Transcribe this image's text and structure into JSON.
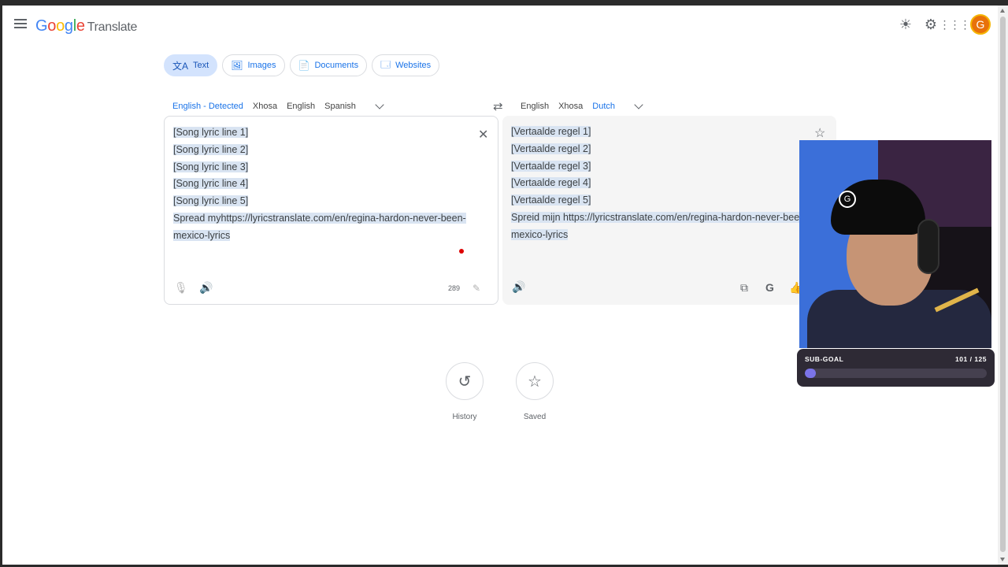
{
  "header": {
    "logo_google": "Google",
    "logo_product": "Translate",
    "avatar_letter": "G"
  },
  "modes": [
    {
      "label": "Text",
      "icon": "translate-icon",
      "active": true
    },
    {
      "label": "Images",
      "icon": "image-icon",
      "active": false
    },
    {
      "label": "Documents",
      "icon": "document-icon",
      "active": false
    },
    {
      "label": "Websites",
      "icon": "website-icon",
      "active": false
    }
  ],
  "source_langs": [
    "English - Detected",
    "Xhosa",
    "English",
    "Spanish"
  ],
  "target_langs": [
    "English",
    "Xhosa",
    "Dutch"
  ],
  "source_text": [
    "[Song lyric line 1]",
    "[Song lyric line 2]",
    "[Song lyric line 3]",
    "[Song lyric line 4]",
    "[Song lyric line 5]",
    "Spread myhttps://lyricstranslate.com/en/regina-hardon-never-been-",
    "mexico-lyrics"
  ],
  "target_text": [
    "[Vertaalde regel 1]",
    "[Vertaalde regel 2]",
    "[Vertaalde regel 3]",
    "[Vertaalde regel 4]",
    "[Vertaalde regel 5]",
    "Spreid mijn https://lyricstranslate.com/en/regina-hardon-never-been",
    "mexico-lyrics"
  ],
  "char_count": "289",
  "history_label": "History",
  "saved_label": "Saved",
  "subgoal": {
    "label": "SUB-GOAL",
    "progress_text": "101 / 125",
    "current": 101,
    "target": 125
  },
  "colors": {
    "accent": "#1a73e8",
    "highlight": "#d9e4f2",
    "subgoal_fill": "#7b74e8"
  }
}
